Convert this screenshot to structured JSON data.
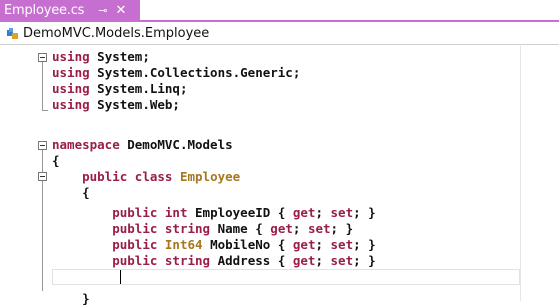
{
  "tab": {
    "title": "Employee.cs",
    "pin_icon": "pin-icon",
    "close_icon": "close-icon"
  },
  "navbar": {
    "class_path": "DemoMVC.Models.Employee",
    "icon": "class-icon"
  },
  "colors": {
    "accent": "#c66fd1",
    "keyword": "#9b1d4a",
    "type": "#a6771f"
  },
  "code": {
    "l1": {
      "kw": "using",
      "rest": " System;"
    },
    "l2": {
      "kw": "using",
      "rest": " System.Collections.Generic;"
    },
    "l3": {
      "kw": "using",
      "rest": " System.Linq;"
    },
    "l4": {
      "kw": "using",
      "rest": " System.Web;"
    },
    "l6": {
      "kw": "namespace",
      "rest": " DemoMVC.Models"
    },
    "l7": {
      "text": "{"
    },
    "l8": {
      "kw1": "public",
      "kw2": "class",
      "type": "Employee"
    },
    "l9": {
      "text": "{"
    },
    "l10": {
      "kw1": "public",
      "kw2": "int",
      "name": "EmployeeID",
      "acc": "{",
      "get": "get",
      "set": "set",
      "end": "}"
    },
    "l11": {
      "kw1": "public",
      "kw2": "string",
      "name": "Name",
      "acc": "{",
      "get": "get",
      "set": "set",
      "end": "}"
    },
    "l12": {
      "kw1": "public",
      "type": "Int64",
      "name": "MobileNo",
      "acc": "{",
      "get": "get",
      "set": "set",
      "end": "}"
    },
    "l13": {
      "kw1": "public",
      "kw2": "string",
      "name": "Address",
      "acc": "{",
      "get": "get",
      "set": "set",
      "end": "}"
    },
    "l15": {
      "text": "}"
    }
  }
}
